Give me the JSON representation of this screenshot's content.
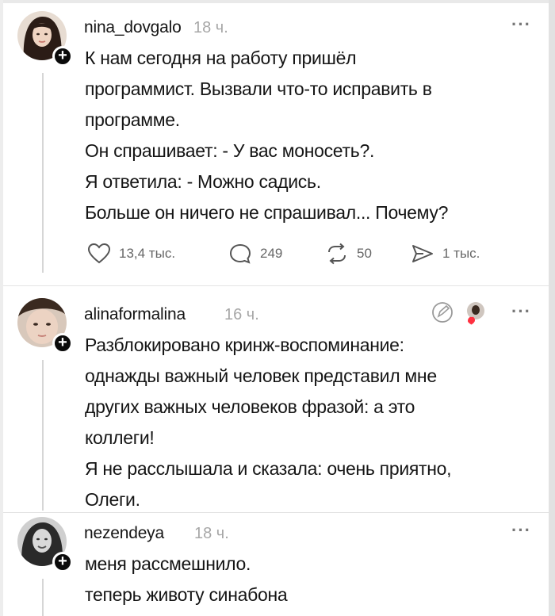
{
  "posts": [
    {
      "username": "nina_dovgalo",
      "time": "18 ч.",
      "lines": [
        "К нам сегодня на работу пришёл",
        "программист. Вызвали что-то исправить в",
        "программе.",
        "Он спрашивает: - У вас моносеть?.",
        "Я ответила: - Можно садись.",
        "Больше он ничего не спрашивал... Почему?"
      ],
      "stats": {
        "likes": "13,4 тыс.",
        "comments": "249",
        "reposts": "50",
        "shares": "1 тыс."
      }
    },
    {
      "username": "alinaformalina",
      "time": "16 ч.",
      "lines": [
        "Разблокировано кринж-воспоминание:",
        "однажды важный человек представил мне",
        "других важных человеков фразой: а это",
        "коллеги!",
        "Я не расслышала и сказала: очень приятно,",
        "Олеги."
      ]
    },
    {
      "username": "nezendeya",
      "time": "18 ч.",
      "lines": [
        "меня рассмешнило.",
        "теперь животу синабона"
      ]
    }
  ],
  "icons": {
    "more": "more-dots-icon",
    "follow": "plus-icon",
    "like": "heart-icon",
    "comment": "comment-icon",
    "repost": "repost-icon",
    "share": "share-icon"
  }
}
